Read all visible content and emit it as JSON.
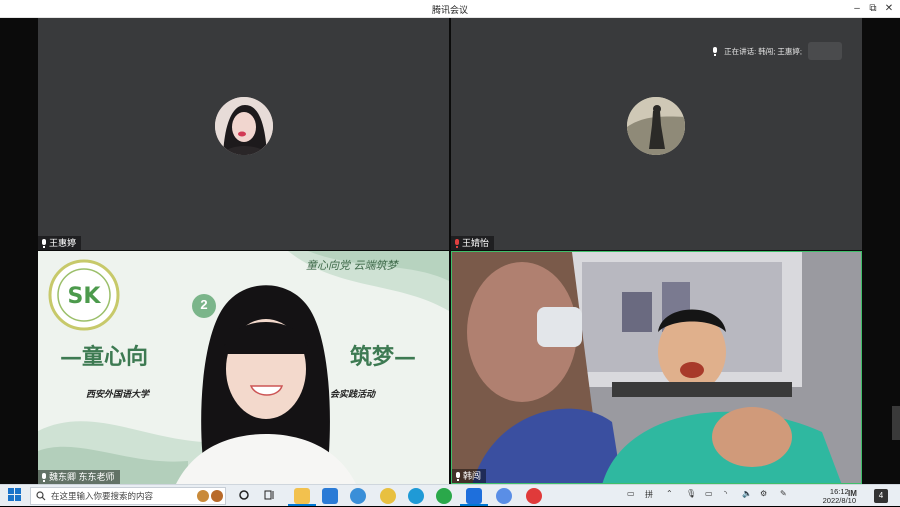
{
  "window": {
    "title": "腾讯会议",
    "controls": {
      "minimize": "–",
      "restore": "⧉",
      "close": "✕"
    }
  },
  "speaking": {
    "label": "正在讲话: 韩闯; 王惠婷;"
  },
  "participants": [
    {
      "name": "王惠婷",
      "mic": "on"
    },
    {
      "name": "王婧怡",
      "mic": "muted"
    },
    {
      "name": "魏东卿 东东老师",
      "mic": "on"
    },
    {
      "name": "韩闯",
      "mic": "on"
    }
  ],
  "slide": {
    "circle_number": "2",
    "banner_left": "—童心向",
    "banner_right": "筑梦—",
    "subtitle_left": "西安外国语大学",
    "subtitle_right": "会实践活动",
    "top_right_calligraphy": "童心向党 云端筑梦"
  },
  "taskbar": {
    "search_placeholder": "在这里输入你要搜索的内容",
    "ime": "拼",
    "time": "16:12",
    "date": "2022/8/10",
    "notification_count": "4",
    "colors": {
      "accent": "#0078d4"
    }
  }
}
